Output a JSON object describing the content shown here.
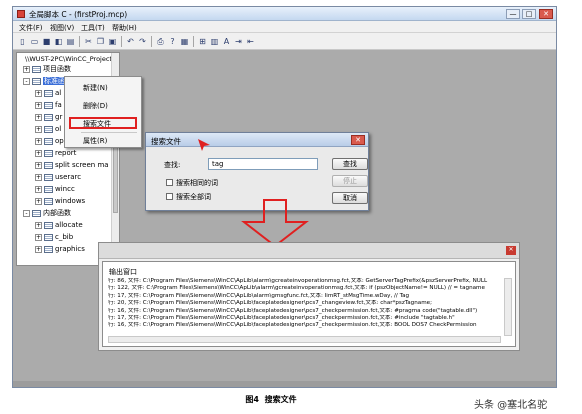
{
  "window": {
    "title": "全局脚本 C - (firstProj.mcp)",
    "minimize": "—",
    "maximize": "□",
    "close": "✕"
  },
  "menu": [
    "文件(F)",
    "视图(V)",
    "工具(T)",
    "帮助(H)"
  ],
  "toolbar_icons": [
    "new-file-icon",
    "open-icon",
    "save-icon",
    "compile-icon",
    "save-all-icon",
    "cut-icon",
    "copy-icon",
    "paste-icon",
    "undo-icon",
    "redo-icon",
    "print-icon",
    "help-icon",
    "function-icon",
    "tag-icon",
    "font-icon",
    "import-icon",
    "export-icon"
  ],
  "tree": {
    "path": "\\\\WUST-2PC\\WinCC_Project_firstPro",
    "nodes": [
      {
        "label": "项目函数",
        "level": 1,
        "pm": "+"
      },
      {
        "label": "标准函数",
        "level": 1,
        "pm": "-",
        "selected": true
      },
      {
        "label": "al",
        "level": 2,
        "pm": "+"
      },
      {
        "label": "fa",
        "level": 2,
        "pm": "+"
      },
      {
        "label": "gr",
        "level": 2,
        "pm": "+"
      },
      {
        "label": "ol",
        "level": 2,
        "pm": "+"
      },
      {
        "label": "op",
        "level": 2,
        "pm": "+"
      },
      {
        "label": "report",
        "level": 2,
        "pm": "+"
      },
      {
        "label": "split screen ma",
        "level": 2,
        "pm": "+"
      },
      {
        "label": "userarc",
        "level": 2,
        "pm": "+"
      },
      {
        "label": "wincc",
        "level": 2,
        "pm": "+"
      },
      {
        "label": "windows",
        "level": 2,
        "pm": "+"
      },
      {
        "label": "内部函数",
        "level": 1,
        "pm": "-"
      },
      {
        "label": "allocate",
        "level": 2,
        "pm": "+"
      },
      {
        "label": "c_bib",
        "level": 2,
        "pm": "+"
      },
      {
        "label": "graphics",
        "level": 2,
        "pm": "+"
      }
    ]
  },
  "context_menu": {
    "items": [
      "新建(N)",
      "删除(D)",
      "搜索文件",
      "属性(R)"
    ],
    "highlighted": "搜索文件"
  },
  "search_dialog": {
    "title": "搜索文件",
    "find_label": "查找:",
    "find_value": "tag",
    "match_word": "搜索相同的词",
    "match_all": "搜索全部词",
    "search_button": "查找",
    "stop_button": "停止",
    "cancel_button": "取消"
  },
  "output": {
    "title": "输出窗口",
    "lines": [
      "行: 86, 文件: C:\\Program Files\\Siemens\\WinCC\\ApLib\\alarm\\gcreateinvoperationmsg.fct,文本:     GetServerTagPrefix(&pszServerPrefix, NULL",
      "行: 122, 文件: C:\\Program Files\\Siemens\\WinCC\\ApLib\\alarm\\gcreateinvoperationmsg.fct,文本:       if (pszObjectName!= NULL)  // = tagname",
      "行: 17, 文件: C:\\Program Files\\Siemens\\WinCC\\ApLib\\alarm\\gmsgfunc.fct,文本:               IimRT_stMsgTime.wDay,          // Tag",
      "行: 20, 文件: C:\\Program Files\\Siemens\\WinCC\\ApLib\\faceplatedesigner\\pcs7_changeview.fct,文本:  char*pszTagname;",
      "行: 16, 文件: C:\\Program Files\\Siemens\\WinCC\\ApLib\\faceplatedesigner\\pcs7_checkpermission.fct,文本:  #pragma code(\"tagtable.dll\")",
      "行: 17, 文件: C:\\Program Files\\Siemens\\WinCC\\ApLib\\faceplatedesigner\\pcs7_checkpermission.fct,文本:  #include \"tagtable.h\"",
      "行: 16, 文件: C:\\Program Files\\Siemens\\WinCC\\ApLib\\faceplatedesigner\\pcs7_checkpermission.fct,文本:  BOOL  DOS7  CheckPermission"
    ]
  },
  "caption": {
    "figure": "图4",
    "text": "搜索文件"
  },
  "watermark": "头条 @塞北名驼"
}
